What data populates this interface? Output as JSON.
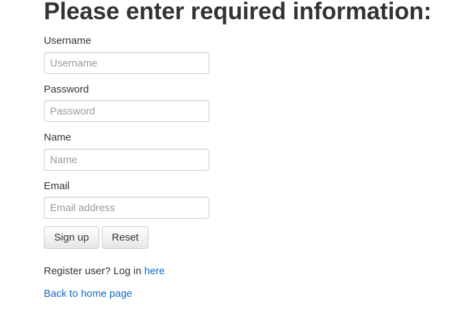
{
  "heading": "Please enter required information:",
  "form": {
    "username": {
      "label": "Username",
      "placeholder": "Username",
      "value": ""
    },
    "password": {
      "label": "Password",
      "placeholder": "Password",
      "value": ""
    },
    "name": {
      "label": "Name",
      "placeholder": "Name",
      "value": ""
    },
    "email": {
      "label": "Email",
      "placeholder": "Email address",
      "value": ""
    }
  },
  "buttons": {
    "signup_label": "Sign up",
    "reset_label": "Reset"
  },
  "login_prompt": {
    "text": "Register user? Log in ",
    "link_label": "here"
  },
  "home_link_label": "Back to home page",
  "colors": {
    "text": "#333333",
    "link": "#0e6bc2",
    "placeholder": "#999999",
    "input_border": "#cccccc"
  }
}
